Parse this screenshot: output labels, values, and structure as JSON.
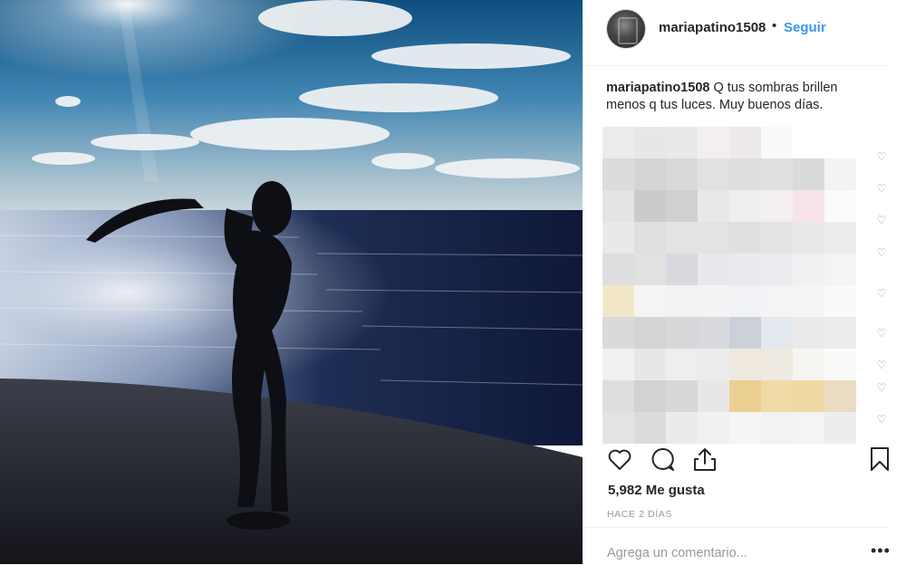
{
  "post": {
    "username": "mariapatino1508",
    "separator": "•",
    "follow_label": "Seguir",
    "caption_text": "Q tus sombras brillen menos q tus luces. Muy buenos días.",
    "likes": "5,982 Me gusta",
    "time_ago": "HACE 2 DÍAS",
    "comment_placeholder": "Agrega un comentario...",
    "more_glyph": "•••"
  },
  "icons": {
    "like": "heart-outline-icon",
    "comment": "speech-bubble-icon",
    "share": "share-upload-icon",
    "save": "bookmark-icon",
    "more": "ellipsis-icon",
    "comment_like": "small-heart-icon"
  },
  "colors": {
    "follow": "#3897f0",
    "text": "#262626",
    "muted": "#999999",
    "divider": "#efefef"
  },
  "pixelated_comments": [
    "#ececec",
    "#e7e7e7",
    "#e9e9e9",
    "#f3efef",
    "#eeeaea",
    "#fafafa",
    "#ffffff",
    "#ffffff",
    "#dcdcdc",
    "#d5d5d5",
    "#d9d9d9",
    "#e1e1e1",
    "#dedede",
    "#e0e0e0",
    "#dadada",
    "#f3f3f3",
    "#e4e4e4",
    "#cbcbcb",
    "#d0d0d0",
    "#e8e8e8",
    "#eeeeee",
    "#f3eef0",
    "#f8e4e8",
    "#fbfbfb",
    "#e9e9e9",
    "#dfdfdf",
    "#e3e3e3",
    "#e3e3e3",
    "#e0e0e0",
    "#e4e4e4",
    "#e8e8e8",
    "#ececec",
    "#dedede",
    "#e1e1e1",
    "#d7d9df",
    "#e7e9ef",
    "#e9ebf1",
    "#ebedf1",
    "#f0f0f0",
    "#f4f4f4",
    "#f3e7ca",
    "#f4f4f4",
    "#f2f2f2",
    "#f3f3f3",
    "#f1f2f5",
    "#f4f4f4",
    "#f5f5f5",
    "#fafafa",
    "#dadada",
    "#d4d4d4",
    "#d6d7d9",
    "#d8dade",
    "#ccd0d9",
    "#e4e8ef",
    "#eaeaea",
    "#ececec",
    "#f1f1f1",
    "#e7e7e7",
    "#eeeeee",
    "#ececec",
    "#efe9df",
    "#eeeae2",
    "#f6f4f0",
    "#fafafa",
    "#dedede",
    "#d2d2d2",
    "#d8d8d8",
    "#e7e7e7",
    "#ebcf92",
    "#f0dba7",
    "#f0d9a2",
    "#eadbc3",
    "#e3e3e3",
    "#dcdcdc",
    "#ebebeb",
    "#f0f0f0",
    "#f5f5f5",
    "#f2f2f2",
    "#f4f4f4",
    "#ededed"
  ]
}
